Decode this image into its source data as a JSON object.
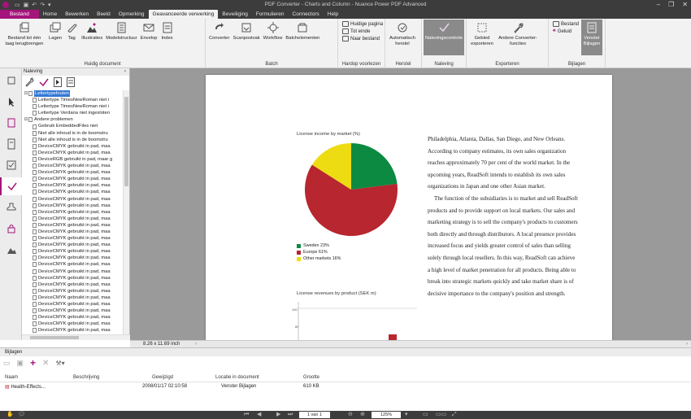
{
  "app": {
    "window_title": "PDF Converter - Charts and Column - Nuance Power PDF Advanced",
    "menu": [
      "Bestand",
      "Home",
      "Bewerken",
      "Beeld",
      "Opmerking",
      "Geavanceerde verwerking",
      "Beveiliging",
      "Formulieren",
      "Connectors",
      "Help"
    ],
    "active_menu": "Geavanceerde verwerking"
  },
  "ribbon": {
    "huidig_document": {
      "label": "Huidig document",
      "buttons": [
        "Bestand tot één laag terugbrengen",
        "Lagen",
        "Tag",
        "Illustraties",
        "Modelstructuur",
        "Envelop",
        "Index"
      ]
    },
    "batch": {
      "label": "Batch",
      "buttons": [
        "Converter",
        "Scanpostvak",
        "Workflow",
        "Batchelementen"
      ]
    },
    "hardop": {
      "label": "Hardop voorlezen",
      "items": [
        "Huidige pagina",
        "Tot einde",
        "Naar bestand"
      ]
    },
    "herstel": {
      "label": "Herstel",
      "button": "Automatisch herstel"
    },
    "naleving": {
      "label": "Naleving",
      "button": "Nalevingscontrole"
    },
    "exporteren": {
      "label": "Exporteren",
      "buttons": [
        "Gebied exporteren",
        "Andere Converter-functies"
      ]
    },
    "bijlagen": {
      "label": "Bijlagen",
      "items": [
        "Bestand",
        "Geluid"
      ],
      "button": "Venster Bijlagen"
    }
  },
  "panel": {
    "title": "Naleving",
    "tree": [
      {
        "indent": 0,
        "toggle": "−",
        "label": "Lettertypefouten",
        "selected": true
      },
      {
        "indent": 1,
        "label": "Lettertype TimesNewRoman niet i"
      },
      {
        "indent": 1,
        "label": "Lettertype TimesNewRoman niet i"
      },
      {
        "indent": 1,
        "label": "Lettertype Verdana niet ingesloten"
      },
      {
        "indent": 0,
        "toggle": "−",
        "label": "Andere problemen"
      },
      {
        "indent": 1,
        "label": "Gebruik EmbeddedFiles niet"
      },
      {
        "indent": 1,
        "label": "Niet alle inhoud is in de boomstru"
      },
      {
        "indent": 1,
        "label": "Niet alle inhoud is in de boomstru"
      },
      {
        "indent": 1,
        "label": "DeviceCMYK gebruikt in pad, maa"
      },
      {
        "indent": 1,
        "label": "DeviceCMYK gebruikt in pad, maa"
      },
      {
        "indent": 1,
        "label": "DeviceRGB gebruikt in pad, maar g"
      },
      {
        "indent": 1,
        "label": "DeviceCMYK gebruikt in pad, maa"
      },
      {
        "indent": 1,
        "label": "DeviceCMYK gebruikt in pad, maa"
      },
      {
        "indent": 1,
        "label": "DeviceCMYK gebruikt in pad, maa"
      },
      {
        "indent": 1,
        "label": "DeviceCMYK gebruikt in pad, maa"
      },
      {
        "indent": 1,
        "label": "DeviceCMYK gebruikt in pad, maa"
      },
      {
        "indent": 1,
        "label": "DeviceCMYK gebruikt in pad, maa"
      },
      {
        "indent": 1,
        "label": "DeviceCMYK gebruikt in pad, maa"
      },
      {
        "indent": 1,
        "label": "DeviceCMYK gebruikt in pad, maa"
      },
      {
        "indent": 1,
        "label": "DeviceCMYK gebruikt in pad, maa"
      },
      {
        "indent": 1,
        "label": "DeviceCMYK gebruikt in pad, maa"
      },
      {
        "indent": 1,
        "label": "DeviceCMYK gebruikt in pad, maa"
      },
      {
        "indent": 1,
        "label": "DeviceCMYK gebruikt in pad, maa"
      },
      {
        "indent": 1,
        "label": "DeviceCMYK gebruikt in pad, maa"
      },
      {
        "indent": 1,
        "label": "DeviceCMYK gebruikt in pad, maa"
      },
      {
        "indent": 1,
        "label": "DeviceCMYK gebruikt in pad, maa"
      },
      {
        "indent": 1,
        "label": "DeviceCMYK gebruikt in pad, maa"
      },
      {
        "indent": 1,
        "label": "DeviceCMYK gebruikt in pad, maa"
      },
      {
        "indent": 1,
        "label": "DeviceCMYK gebruikt in pad, maa"
      },
      {
        "indent": 1,
        "label": "DeviceCMYK gebruikt in pad, maa"
      },
      {
        "indent": 1,
        "label": "DeviceCMYK gebruikt in pad, maa"
      },
      {
        "indent": 1,
        "label": "DeviceCMYK gebruikt in pad, maa"
      },
      {
        "indent": 1,
        "label": "DeviceCMYK gebruikt in pad, maa"
      },
      {
        "indent": 1,
        "label": "DeviceCMYK gebruikt in pad, maa"
      },
      {
        "indent": 1,
        "label": "DeviceCMYK gebruikt in pad, maa"
      },
      {
        "indent": 1,
        "label": "DeviceCMYK gebruikt in pad, maa"
      },
      {
        "indent": 1,
        "label": "DeviceCMYK gebruikt in pad, maa"
      }
    ]
  },
  "document": {
    "page_size": "8.26 x 11.69 inch",
    "pie_chart_title": "License income by market (%)",
    "bar_chart_title": "License revenues by product (SEK m)",
    "bar_axis_labels": [
      "100",
      "80",
      "60"
    ],
    "paragraph1": "Philadelphia, Atlanta, Dallas, San Diego, and New Orleans. According to company estimates, its own sales organization reaches approximately 70 per cent of the world market. In the upcoming years, ReadSoft intends to establish its own sales organizations in Japan and one other Asian market.",
    "paragraph2": "The function of the subsidiaries is to market and sell ReadSoft products and to provide support on local markets. Our sales and marketing strategy is to sell the company's products to customers both directly and through distributors. A local presence provides increased focus and yields greater control of sales than selling solely through local resellers. In this way, ReadSoft can achieve a high level of market penetration for all products. Being able to break into strategic markets quickly and take market share is of decisive importance to the company's position and strength."
  },
  "chart_data": {
    "type": "pie",
    "title": "License income by market (%)",
    "categories": [
      "Sweden 23%",
      "Europe 61%",
      "Other markets 16%"
    ],
    "values": [
      23,
      61,
      16
    ],
    "colors": [
      "#0c8a42",
      "#b8262f",
      "#eedc12"
    ],
    "legend": "bottom-left"
  },
  "attachments": {
    "title": "Bijlagen",
    "columns": [
      "Naam",
      "Beschrijving",
      "Gewijzigd",
      "Locatie in document",
      "Grootte"
    ],
    "rows": [
      {
        "name": "Health-Effects...",
        "description": "",
        "modified": "2008/01/17 02:10:58",
        "location": "Venster Bijlagen",
        "size": "610 KB"
      }
    ]
  },
  "statusbar": {
    "page": "1 van 1",
    "zoom": "125%"
  },
  "colors": {
    "accent": "#a4147a",
    "dark": "#3c3c3c",
    "ribbon": "#f2f2f2"
  }
}
